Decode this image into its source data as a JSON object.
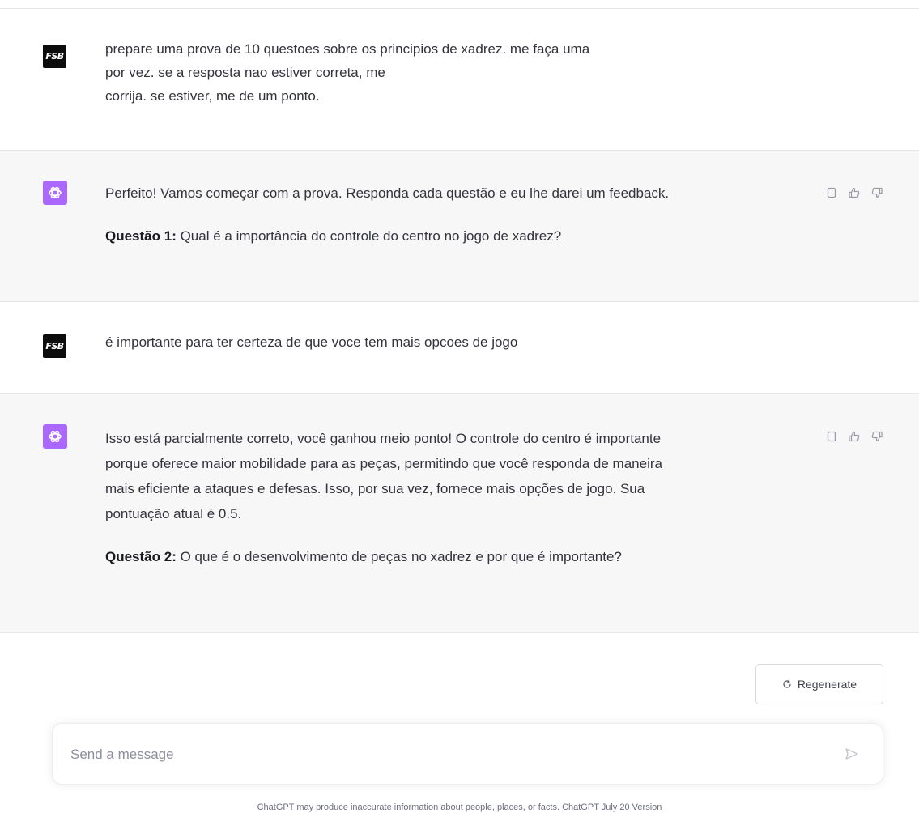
{
  "conversation": {
    "messages": [
      {
        "role": "user",
        "avatar_text": "FSB",
        "lines": [
          "prepare uma prova de 10 questoes sobre os principios de xadrez. me faça uma",
          "por vez. se a resposta nao estiver correta, me",
          "corrija. se estiver, me de um ponto."
        ]
      },
      {
        "role": "assistant",
        "paragraph1": "Perfeito! Vamos começar com a prova. Responda cada questão e eu lhe darei um feedback.",
        "question_label": "Questão 1:",
        "question_text": " Qual é a importância do controle do centro no jogo de xadrez?"
      },
      {
        "role": "user",
        "avatar_text": "FSB",
        "text": "é importante para ter certeza de que voce tem mais opcoes de jogo"
      },
      {
        "role": "assistant",
        "lines": [
          "Isso está parcialmente correto, você ganhou meio ponto! O controle do centro é importante",
          "porque oferece maior mobilidade para as peças, permitindo que você responda de maneira",
          "mais eficiente a ataques e defesas. Isso, por sua vez, fornece mais opções de jogo. Sua",
          "pontuação atual é 0.5."
        ],
        "question_label": "Questão 2:",
        "question_text": " O que é o desenvolvimento de peças no xadrez e por que é importante?"
      }
    ]
  },
  "actions": {
    "regenerate_label": "Regenerate"
  },
  "composer": {
    "placeholder": "Send a message"
  },
  "footer": {
    "disclaimer": "ChatGPT may produce inaccurate information about people, places, or facts. ",
    "version_link": "ChatGPT July 20 Version"
  },
  "colors": {
    "assistant_avatar": "#ab68ff",
    "user_avatar": "#0c0c0c",
    "assistant_bg": "#f7f7f8"
  },
  "icons": [
    "copy-icon",
    "thumbs-up-icon",
    "thumbs-down-icon",
    "refresh-icon",
    "send-icon",
    "openai-logo-icon"
  ]
}
